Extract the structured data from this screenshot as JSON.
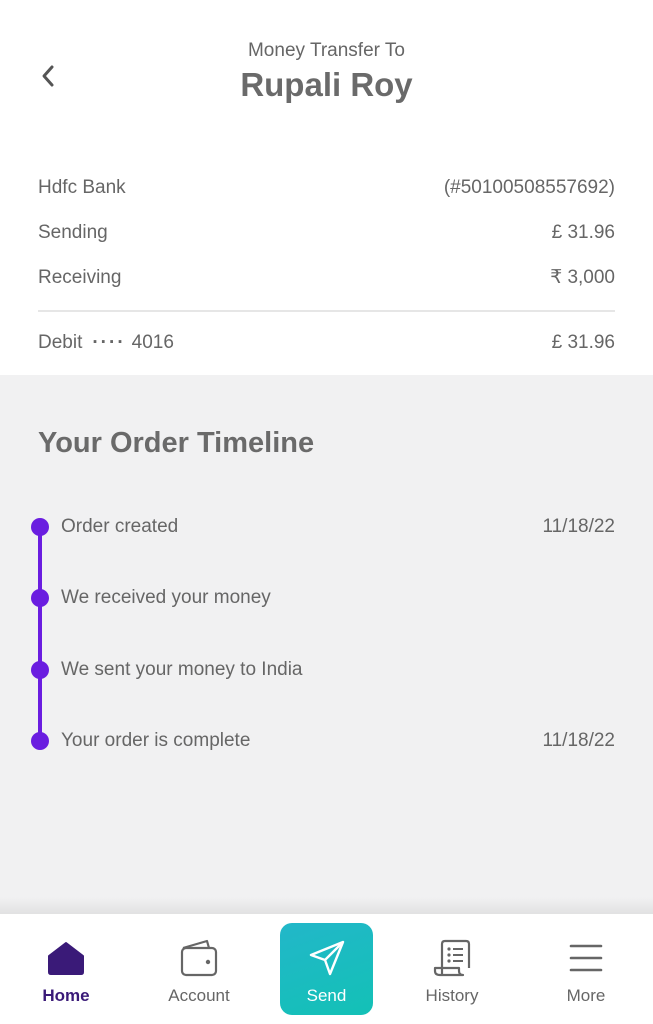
{
  "header": {
    "subtitle": "Money Transfer To",
    "title": "Rupali Roy"
  },
  "details": {
    "bank_label": "Hdfc Bank",
    "bank_account": "(#50100508557692)",
    "sending_label": "Sending",
    "sending_value": "£ 31.96",
    "receiving_label": "Receiving",
    "receiving_value": "₹ 3,000",
    "debit_label": "Debit",
    "debit_mask": "····",
    "debit_last4": "4016",
    "debit_value": "£ 31.96"
  },
  "timeline": {
    "heading": "Your Order Timeline",
    "steps": [
      {
        "label": "Order created",
        "date": "11/18/22"
      },
      {
        "label": "We received your money",
        "date": ""
      },
      {
        "label": "We sent your money to India",
        "date": ""
      },
      {
        "label": "Your order is complete",
        "date": "11/18/22"
      }
    ],
    "accent": "#6a1de0"
  },
  "nav": {
    "items": [
      {
        "label": "Home",
        "icon": "home-icon",
        "active": true
      },
      {
        "label": "Account",
        "icon": "wallet-icon",
        "active": false
      },
      {
        "label": "Send",
        "icon": "send-icon",
        "active": false
      },
      {
        "label": "History",
        "icon": "receipt-icon",
        "active": false
      },
      {
        "label": "More",
        "icon": "menu-icon",
        "active": false
      }
    ],
    "send_color": "#16bcbf",
    "active_color": "#3a1a78"
  }
}
